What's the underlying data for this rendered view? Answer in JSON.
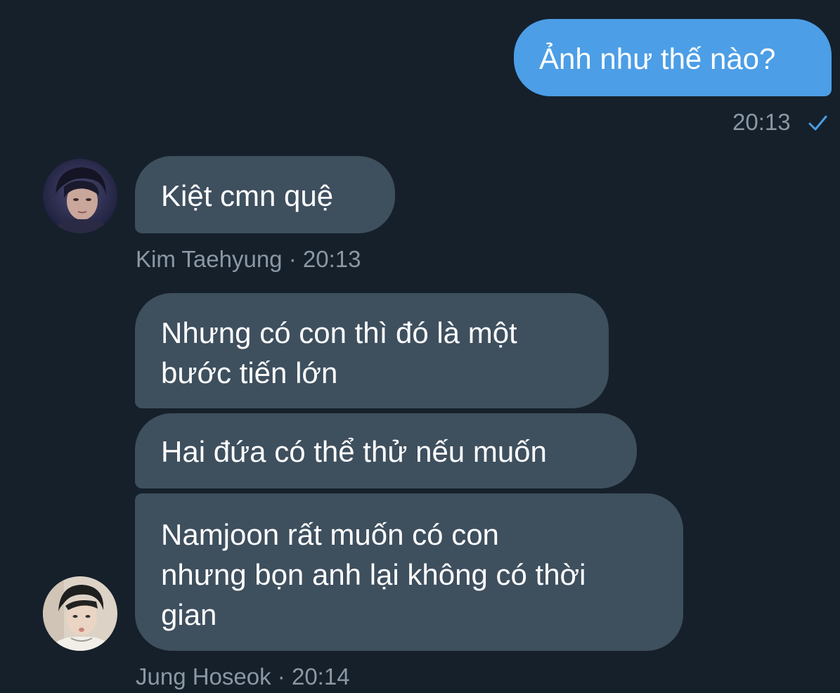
{
  "colors": {
    "background": "#15202b",
    "outgoing_bubble": "#4c9ee6",
    "incoming_bubble": "#3e4f5e",
    "meta_text": "#8b98a5",
    "read_check": "#4c9ee6"
  },
  "conversation": {
    "outgoing": {
      "text": "Ảnh như thế nào?",
      "time": "20:13",
      "status_icon": "check-icon"
    },
    "group1": {
      "avatar_icon": "user-avatar",
      "messages": [
        "Kiệt cmn quệ"
      ],
      "sender": "Kim Taehyung",
      "time": "20:13"
    },
    "group2": {
      "avatar_icon": "user-avatar",
      "messages": [
        [
          "Nhưng có con thì đó là một",
          "bước tiến lớn"
        ],
        [
          "Hai đứa có thể thử nếu muốn"
        ],
        [
          "Namjoon rất muốn có con",
          "nhưng bọn anh lại không có thời",
          "gian"
        ]
      ],
      "sender": "Jung Hoseok",
      "time": "20:14"
    }
  }
}
